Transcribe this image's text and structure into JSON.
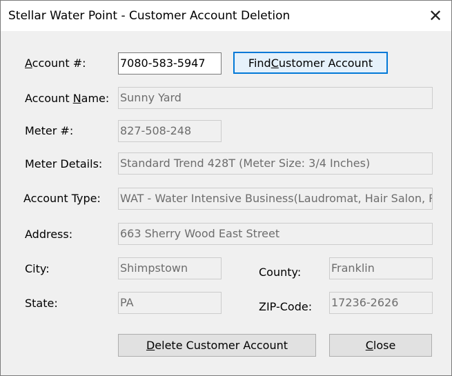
{
  "window": {
    "title": "Stellar Water Point - Customer Account Deletion",
    "close_glyph": "✕"
  },
  "labels": {
    "account_number": {
      "pre": "",
      "key": "A",
      "post": "ccount #:"
    },
    "account_name": {
      "pre": "Account ",
      "key": "N",
      "post": "ame:"
    },
    "meter_number": "Meter #:",
    "meter_details": "Meter Details:",
    "account_type": "Account Type:",
    "address": "Address:",
    "city": "City:",
    "county": "County:",
    "state": "State:",
    "zip_code": "ZIP-Code:"
  },
  "fields": {
    "account_number": "7080-583-5947",
    "account_name": "Sunny Yard",
    "meter_number": "827-508-248",
    "meter_details": "Standard Trend 428T (Meter Size: 3/4 Inches)",
    "account_type": "WAT - Water Intensive Business(Laudromat, Hair Salon, Re",
    "address": "663 Sherry Wood East Street",
    "city": "Shimpstown",
    "county": "Franklin",
    "state": "PA",
    "zip_code": "17236-2626"
  },
  "buttons": {
    "find": {
      "pre": "Find ",
      "key": "C",
      "post": "ustomer Account"
    },
    "delete": {
      "pre": "",
      "key": "D",
      "post": "elete Customer Account"
    },
    "close": {
      "pre": "",
      "key": "C",
      "post": "lose"
    }
  }
}
